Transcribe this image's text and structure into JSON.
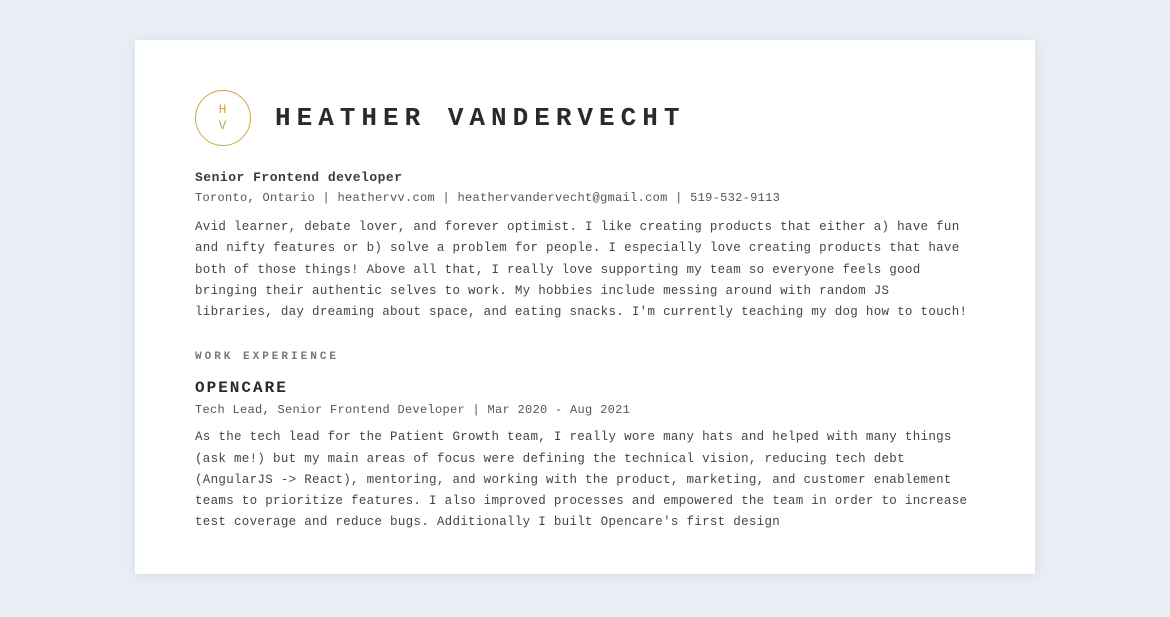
{
  "header": {
    "initials_top": "H",
    "initials_bottom": "V",
    "name": "HEATHER  VANDERVECHT",
    "job_title": "Senior Frontend developer",
    "contact": "Toronto, Ontario | heathervv.com | heathervandervecht@gmail.com | 519-532-9113",
    "bio": "Avid learner, debate lover, and forever optimist. I like creating products that either a) have fun and nifty features or b) solve a problem for people. I especially love creating products that have both of those things! Above all that, I really love supporting my team so everyone feels good bringing their authentic selves to work. My hobbies include messing around with random JS libraries, day dreaming about space, and eating snacks. I'm currently teaching my dog how to touch!"
  },
  "sections": {
    "work_experience_label": "WORK EXPERIENCE",
    "jobs": [
      {
        "company": "OPENCARE",
        "role_date": "Tech Lead, Senior Frontend Developer | Mar 2020 - Aug 2021",
        "description": "As the tech lead for the Patient Growth team, I really wore many hats and helped with many things (ask me!) but my main areas of focus were defining the technical vision, reducing tech debt (AngularJS -> React), mentoring, and working with the product, marketing, and customer enablement teams to prioritize features. I also improved processes and empowered the team in order to increase test coverage and reduce bugs. Additionally I built Opencare's first design"
      }
    ]
  }
}
